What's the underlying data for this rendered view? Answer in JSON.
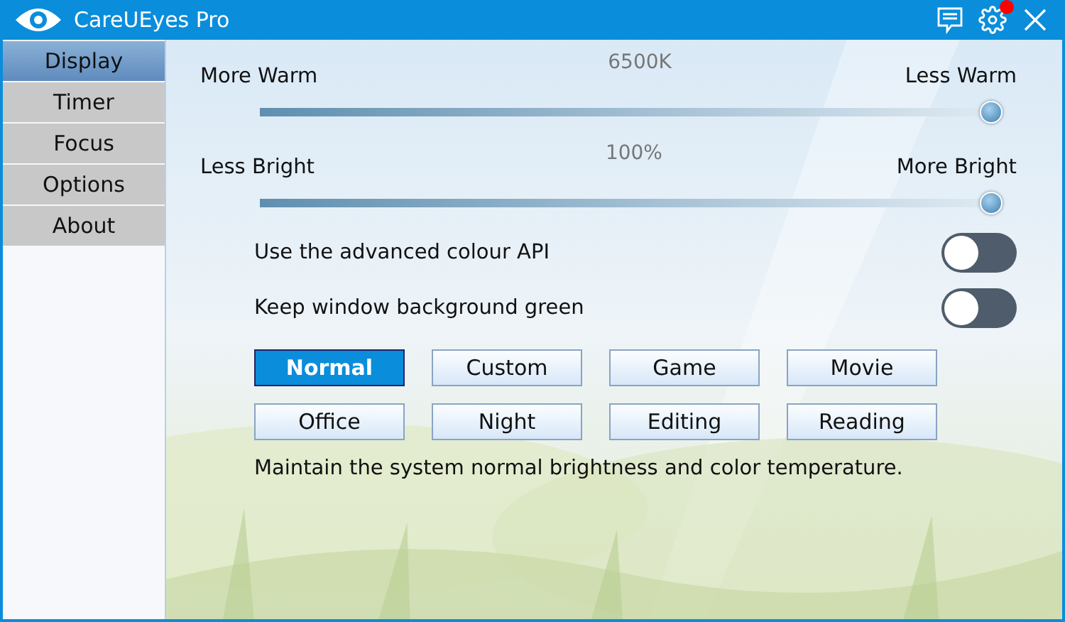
{
  "window": {
    "title": "CareUEyes Pro",
    "notification": true
  },
  "sidebar": {
    "items": [
      {
        "label": "Display",
        "selected": true
      },
      {
        "label": "Timer",
        "selected": false
      },
      {
        "label": "Focus",
        "selected": false
      },
      {
        "label": "Options",
        "selected": false
      },
      {
        "label": "About",
        "selected": false
      }
    ]
  },
  "sliders": [
    {
      "left_label": "More Warm",
      "reading": "6500K",
      "right_label": "Less Warm",
      "level": 1
    },
    {
      "left_label": "Less Bright",
      "reading": "100%",
      "right_label": "More Bright",
      "level": 1
    }
  ],
  "toggles": [
    {
      "label": "Use the advanced colour API",
      "on": false
    },
    {
      "label": "Keep window background green",
      "on": false
    }
  ],
  "presets": [
    {
      "label": "Normal",
      "selected": true
    },
    {
      "label": "Custom",
      "selected": false
    },
    {
      "label": "Game",
      "selected": false
    },
    {
      "label": "Movie",
      "selected": false
    },
    {
      "label": "Office",
      "selected": false
    },
    {
      "label": "Night",
      "selected": false
    },
    {
      "label": "Editing",
      "selected": false
    },
    {
      "label": "Reading",
      "selected": false
    }
  ],
  "description": "Maintain the system normal brightness and color temperature."
}
